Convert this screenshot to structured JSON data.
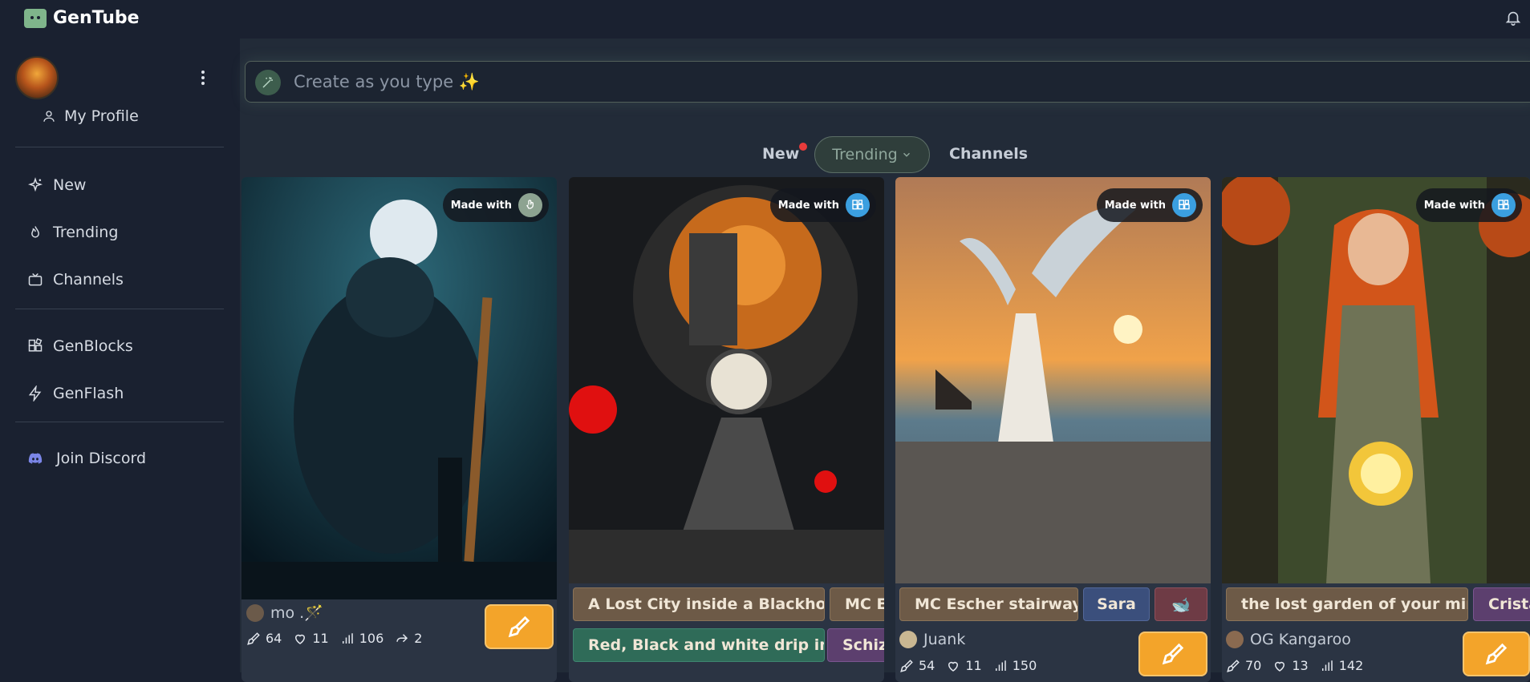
{
  "app": {
    "title": "GenTube"
  },
  "header": {
    "bell": "bell-icon"
  },
  "sidebar": {
    "profile_label": "My Profile",
    "nav": [
      {
        "label": "New",
        "icon": "sparkle-icon"
      },
      {
        "label": "Trending",
        "icon": "flame-icon"
      },
      {
        "label": "Channels",
        "icon": "tv-icon"
      }
    ],
    "tools": [
      {
        "label": "GenBlocks",
        "icon": "blocks-icon"
      },
      {
        "label": "GenFlash",
        "icon": "bolt-icon"
      }
    ],
    "discord_label": "Join Discord"
  },
  "search": {
    "placeholder": "Create as you type ✨"
  },
  "tabs": {
    "new": "New",
    "trending": "Trending",
    "channels": "Channels"
  },
  "made_with_label": "Made with",
  "cards": [
    {
      "author": "mo .🪄",
      "stats": {
        "remixes": "64",
        "likes": "11",
        "views": "106",
        "shares": "2"
      }
    },
    {
      "tags": [
        "A Lost City inside a Blackhole",
        "MC E",
        "Red, Black and white drip ink",
        "Schiz"
      ]
    },
    {
      "tags": [
        "MC Escher stairway",
        "Sara",
        "🐋"
      ],
      "author": "Juank",
      "stats": {
        "remixes": "54",
        "likes": "11",
        "views": "150"
      }
    },
    {
      "tags": [
        "the lost garden of your mind",
        "Crista"
      ],
      "author": "OG Kangaroo",
      "stats": {
        "remixes": "70",
        "likes": "13",
        "views": "142"
      }
    }
  ],
  "colors": {
    "accent": "#f3a42a",
    "background": "#1a2130",
    "panel": "#222b38",
    "new_dot": "#e83b3b"
  }
}
